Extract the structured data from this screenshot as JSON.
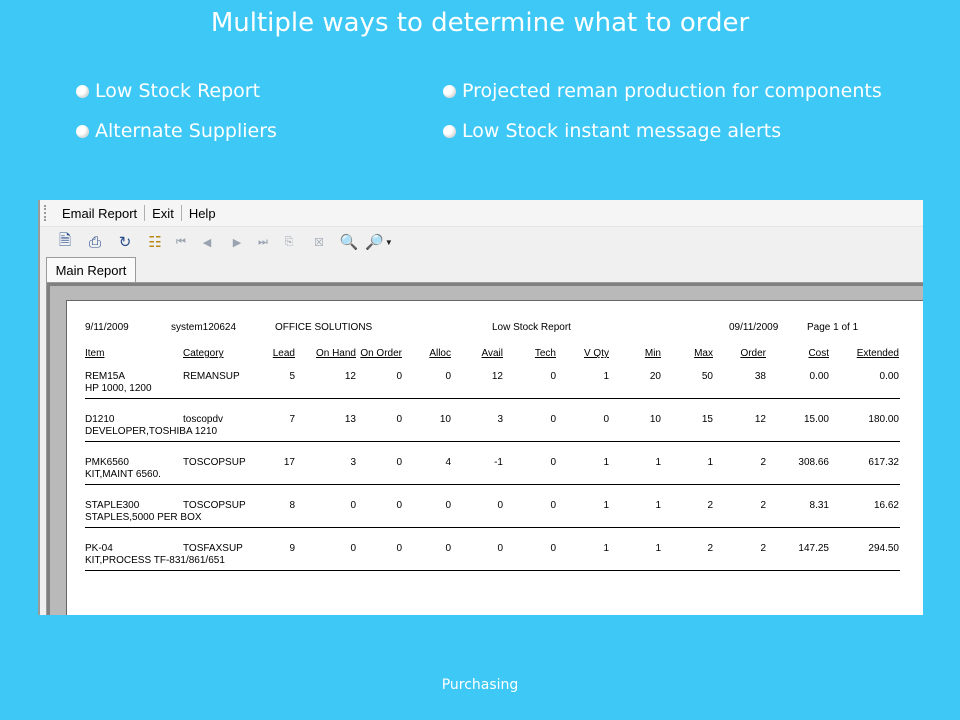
{
  "slide": {
    "title": "Multiple ways to determine what to order",
    "bullets": [
      "Low Stock Report",
      "Alternate Suppliers",
      "Projected reman production for components",
      "Low Stock instant message alerts"
    ],
    "footer": "Purchasing"
  },
  "menu": [
    "Email Report",
    "Exit",
    "Help"
  ],
  "toolbar_icons": [
    "export-icon",
    "print-icon",
    "refresh-icon",
    "group-tree-icon",
    "first-page-icon",
    "prev-page-icon",
    "next-page-icon",
    "last-page-icon",
    "goto-page-icon",
    "stop-icon",
    "find-icon",
    "zoom-icon"
  ],
  "tab": "Main Report",
  "report": {
    "date": "9/11/2009",
    "user": "system120624",
    "company": "OFFICE SOLUTIONS",
    "title": "Low Stock Report",
    "print_date": "09/11/2009",
    "page": "Page 1 of 1",
    "columns": [
      "Item",
      "Category",
      "Lead",
      "On Hand",
      "On Order",
      "Alloc",
      "Avail",
      "Tech",
      "V Qty",
      "Min",
      "Max",
      "Order",
      "Cost",
      "Extended"
    ],
    "rows": [
      {
        "item": "REM15A",
        "desc": "HP 1000, 1200",
        "category": "REMANSUP",
        "lead": "5",
        "on_hand": "12",
        "on_order": "0",
        "alloc": "0",
        "avail": "12",
        "tech": "0",
        "vqty": "1",
        "min": "20",
        "max": "50",
        "order": "38",
        "cost": "0.00",
        "extended": "0.00"
      },
      {
        "item": "D1210",
        "desc": "DEVELOPER,TOSHIBA 1210",
        "category": "toscopdv",
        "lead": "7",
        "on_hand": "13",
        "on_order": "0",
        "alloc": "10",
        "avail": "3",
        "tech": "0",
        "vqty": "0",
        "min": "10",
        "max": "15",
        "order": "12",
        "cost": "15.00",
        "extended": "180.00"
      },
      {
        "item": "PMK6560",
        "desc": "KIT,MAINT 6560.",
        "category": "TOSCOPSUP",
        "lead": "17",
        "on_hand": "3",
        "on_order": "0",
        "alloc": "4",
        "avail": "-1",
        "tech": "0",
        "vqty": "1",
        "min": "1",
        "max": "1",
        "order": "2",
        "cost": "308.66",
        "extended": "617.32"
      },
      {
        "item": "STAPLE300",
        "desc": "STAPLES,5000 PER BOX",
        "category": "TOSCOPSUP",
        "lead": "8",
        "on_hand": "0",
        "on_order": "0",
        "alloc": "0",
        "avail": "0",
        "tech": "0",
        "vqty": "1",
        "min": "1",
        "max": "2",
        "order": "2",
        "cost": "8.31",
        "extended": "16.62"
      },
      {
        "item": "PK-04",
        "desc": "KIT,PROCESS TF-831/861/651",
        "category": "TOSFAXSUP",
        "lead": "9",
        "on_hand": "0",
        "on_order": "0",
        "alloc": "0",
        "avail": "0",
        "tech": "0",
        "vqty": "1",
        "min": "1",
        "max": "2",
        "order": "2",
        "cost": "147.25",
        "extended": "294.50"
      }
    ]
  }
}
